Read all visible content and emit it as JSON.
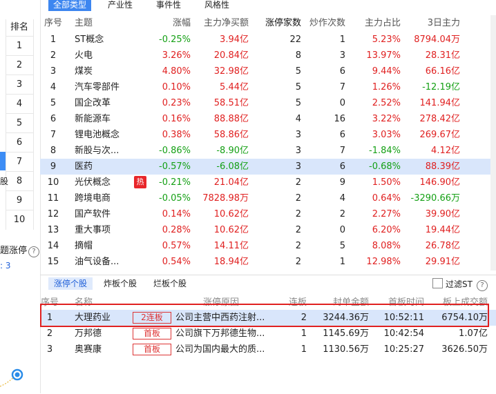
{
  "top_tabs": [
    "全部类型",
    "产业性",
    "事件性",
    "风格性"
  ],
  "left": {
    "rank_header": "排名",
    "ranks": [
      "1",
      "2",
      "3",
      "4",
      "5",
      "6",
      "7",
      "8",
      "9",
      "10"
    ],
    "frag_ban": "股",
    "frag_title": "题涨停",
    "frag_count": ": 3"
  },
  "table": {
    "headers": {
      "no": "序号",
      "name": "主题",
      "chg": "涨幅",
      "net": "主力净买额",
      "cnt": "涨停家数",
      "hype": "炒作次数",
      "ratio": "主力占比",
      "d3": "3日主力"
    },
    "rows": [
      {
        "no": "1",
        "name": "ST概念",
        "chg": "-0.25%",
        "net": "3.94亿",
        "cnt": "22",
        "hype": "1",
        "ratio": "5.23%",
        "d3": "8794.04万"
      },
      {
        "no": "2",
        "name": "火电",
        "chg": "3.26%",
        "net": "20.84亿",
        "cnt": "8",
        "hype": "3",
        "ratio": "13.97%",
        "d3": "28.31亿"
      },
      {
        "no": "3",
        "name": "煤炭",
        "chg": "4.80%",
        "net": "32.98亿",
        "cnt": "5",
        "hype": "6",
        "ratio": "9.44%",
        "d3": "66.16亿"
      },
      {
        "no": "4",
        "name": "汽车零部件",
        "chg": "0.10%",
        "net": "5.44亿",
        "cnt": "5",
        "hype": "7",
        "ratio": "1.26%",
        "d3": "-12.19亿"
      },
      {
        "no": "5",
        "name": "国企改革",
        "chg": "0.23%",
        "net": "58.51亿",
        "cnt": "5",
        "hype": "0",
        "ratio": "2.52%",
        "d3": "141.94亿"
      },
      {
        "no": "6",
        "name": "新能源车",
        "chg": "0.16%",
        "net": "88.88亿",
        "cnt": "4",
        "hype": "16",
        "ratio": "3.22%",
        "d3": "278.42亿"
      },
      {
        "no": "7",
        "name": "锂电池概念",
        "chg": "0.38%",
        "net": "58.86亿",
        "cnt": "3",
        "hype": "6",
        "ratio": "3.03%",
        "d3": "269.67亿"
      },
      {
        "no": "8",
        "name": "新股与次...",
        "chg": "-0.86%",
        "net": "-8.90亿",
        "cnt": "3",
        "hype": "7",
        "ratio": "-1.84%",
        "d3": "4.12亿"
      },
      {
        "no": "9",
        "name": "医药",
        "chg": "-0.57%",
        "net": "-6.08亿",
        "cnt": "3",
        "hype": "6",
        "ratio": "-0.68%",
        "d3": "88.39亿"
      },
      {
        "no": "10",
        "name": "光伏概念",
        "chg": "-0.21%",
        "net": "21.04亿",
        "cnt": "2",
        "hype": "9",
        "ratio": "1.50%",
        "d3": "146.90亿"
      },
      {
        "no": "11",
        "name": "跨境电商",
        "chg": "-0.05%",
        "net": "7828.98万",
        "cnt": "2",
        "hype": "4",
        "ratio": "0.64%",
        "d3": "-3290.66万"
      },
      {
        "no": "12",
        "name": "国产软件",
        "chg": "0.14%",
        "net": "10.62亿",
        "cnt": "2",
        "hype": "2",
        "ratio": "2.27%",
        "d3": "39.90亿"
      },
      {
        "no": "13",
        "name": "重大事项",
        "chg": "0.28%",
        "net": "10.62亿",
        "cnt": "2",
        "hype": "0",
        "ratio": "6.20%",
        "d3": "19.44亿"
      },
      {
        "no": "14",
        "name": "摘帽",
        "chg": "0.57%",
        "net": "14.11亿",
        "cnt": "2",
        "hype": "5",
        "ratio": "8.08%",
        "d3": "26.78亿"
      },
      {
        "no": "15",
        "name": "油气设备...",
        "chg": "0.54%",
        "net": "18.94亿",
        "cnt": "2",
        "hype": "1",
        "ratio": "12.98%",
        "d3": "29.91亿"
      }
    ],
    "hot_badge": "热"
  },
  "bottom": {
    "tabs": [
      "涨停个股",
      "炸板个股",
      "烂板个股"
    ],
    "filter_label": "过滤ST",
    "help": "?",
    "headers": {
      "no": "序号",
      "name": "名称",
      "reason": "涨停原因",
      "lb": "连板",
      "amt": "封单金额",
      "first": "首板时间",
      "vol": "板上成交额"
    },
    "rows": [
      {
        "no": "1",
        "name": "大理药业",
        "badge": "2连板",
        "reason": "公司主营中西药注射...",
        "lb": "2",
        "amt": "3244.36万",
        "first": "10:52:11",
        "vol": "6754.10万"
      },
      {
        "no": "2",
        "name": "万邦德",
        "badge": "首板",
        "reason": "公司旗下万邦德生物...",
        "lb": "1",
        "amt": "1145.69万",
        "first": "10:42:54",
        "vol": "1.07亿"
      },
      {
        "no": "3",
        "name": "奥赛康",
        "badge": "首板",
        "reason": "公司为国内最大的质...",
        "lb": "1",
        "amt": "1130.56万",
        "first": "10:25:27",
        "vol": "3626.50万"
      }
    ]
  }
}
